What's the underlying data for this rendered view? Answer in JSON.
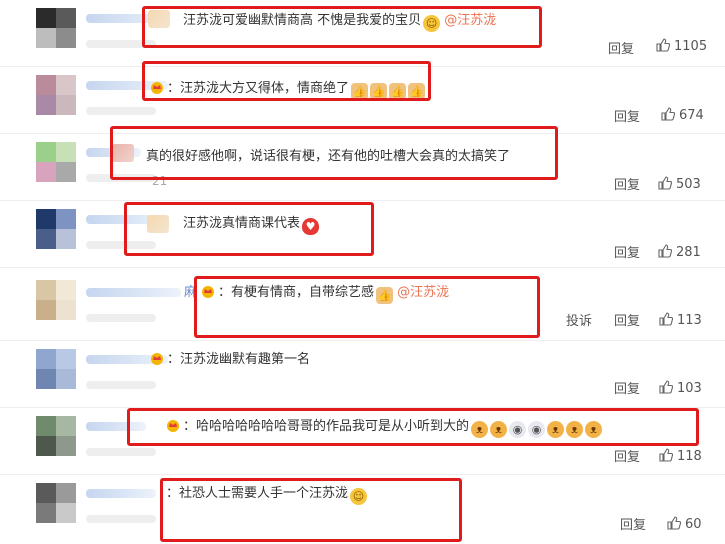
{
  "comments": [
    {
      "text": "汪苏泷可爱幽默情商高 不愧是我爱的宝贝",
      "emojis": [
        "smile-face"
      ],
      "mention": "@汪苏泷",
      "reply_label": "回复",
      "likes": "1105",
      "crown": false
    },
    {
      "text": "：汪苏泷大方又得体，情商绝了",
      "emojis": [
        "thumbs-up",
        "thumbs-up",
        "thumbs-up",
        "thumbs-up"
      ],
      "mention": "",
      "reply_label": "回复",
      "likes": "674",
      "crown": true
    },
    {
      "text": "真的很好感他啊，说话很有梗，还有他的吐槽大会真的太搞笑了",
      "emojis": [],
      "mention": "",
      "reply_label": "回复",
      "likes": "503",
      "crown": false,
      "meta_fragment": "21"
    },
    {
      "text": "汪苏泷真情商课代表",
      "emojis": [
        "heart"
      ],
      "mention": "",
      "reply_label": "回复",
      "likes": "281",
      "crown": false
    },
    {
      "prefix": "麻",
      "text": "：有梗有情商，自带综艺感",
      "emojis": [
        "thumbs-up"
      ],
      "mention": "@汪苏泷",
      "report_label": "投诉",
      "reply_label": "回复",
      "likes": "113",
      "crown": true
    },
    {
      "text": "：汪苏泷幽默有趣第一名",
      "emojis": [],
      "mention": "",
      "reply_label": "回复",
      "likes": "103",
      "crown": true
    },
    {
      "text": "：哈哈哈哈哈哈哈哥哥的作品我可是从小听到大的",
      "emojis": [
        "cat",
        "cat",
        "ghost",
        "ghost",
        "cat",
        "cat",
        "cat"
      ],
      "mention": "",
      "reply_label": "回复",
      "likes": "118",
      "crown": true
    },
    {
      "text": "：社恐人士需要人手一个汪苏泷",
      "emojis": [
        "thinking-face"
      ],
      "mention": "",
      "reply_label": "回复",
      "likes": "60",
      "crown": false
    }
  ],
  "colors": {
    "highlight_box": "#e01b1b",
    "mention": "#eb7350",
    "text": "#333333",
    "action": "#555555"
  }
}
